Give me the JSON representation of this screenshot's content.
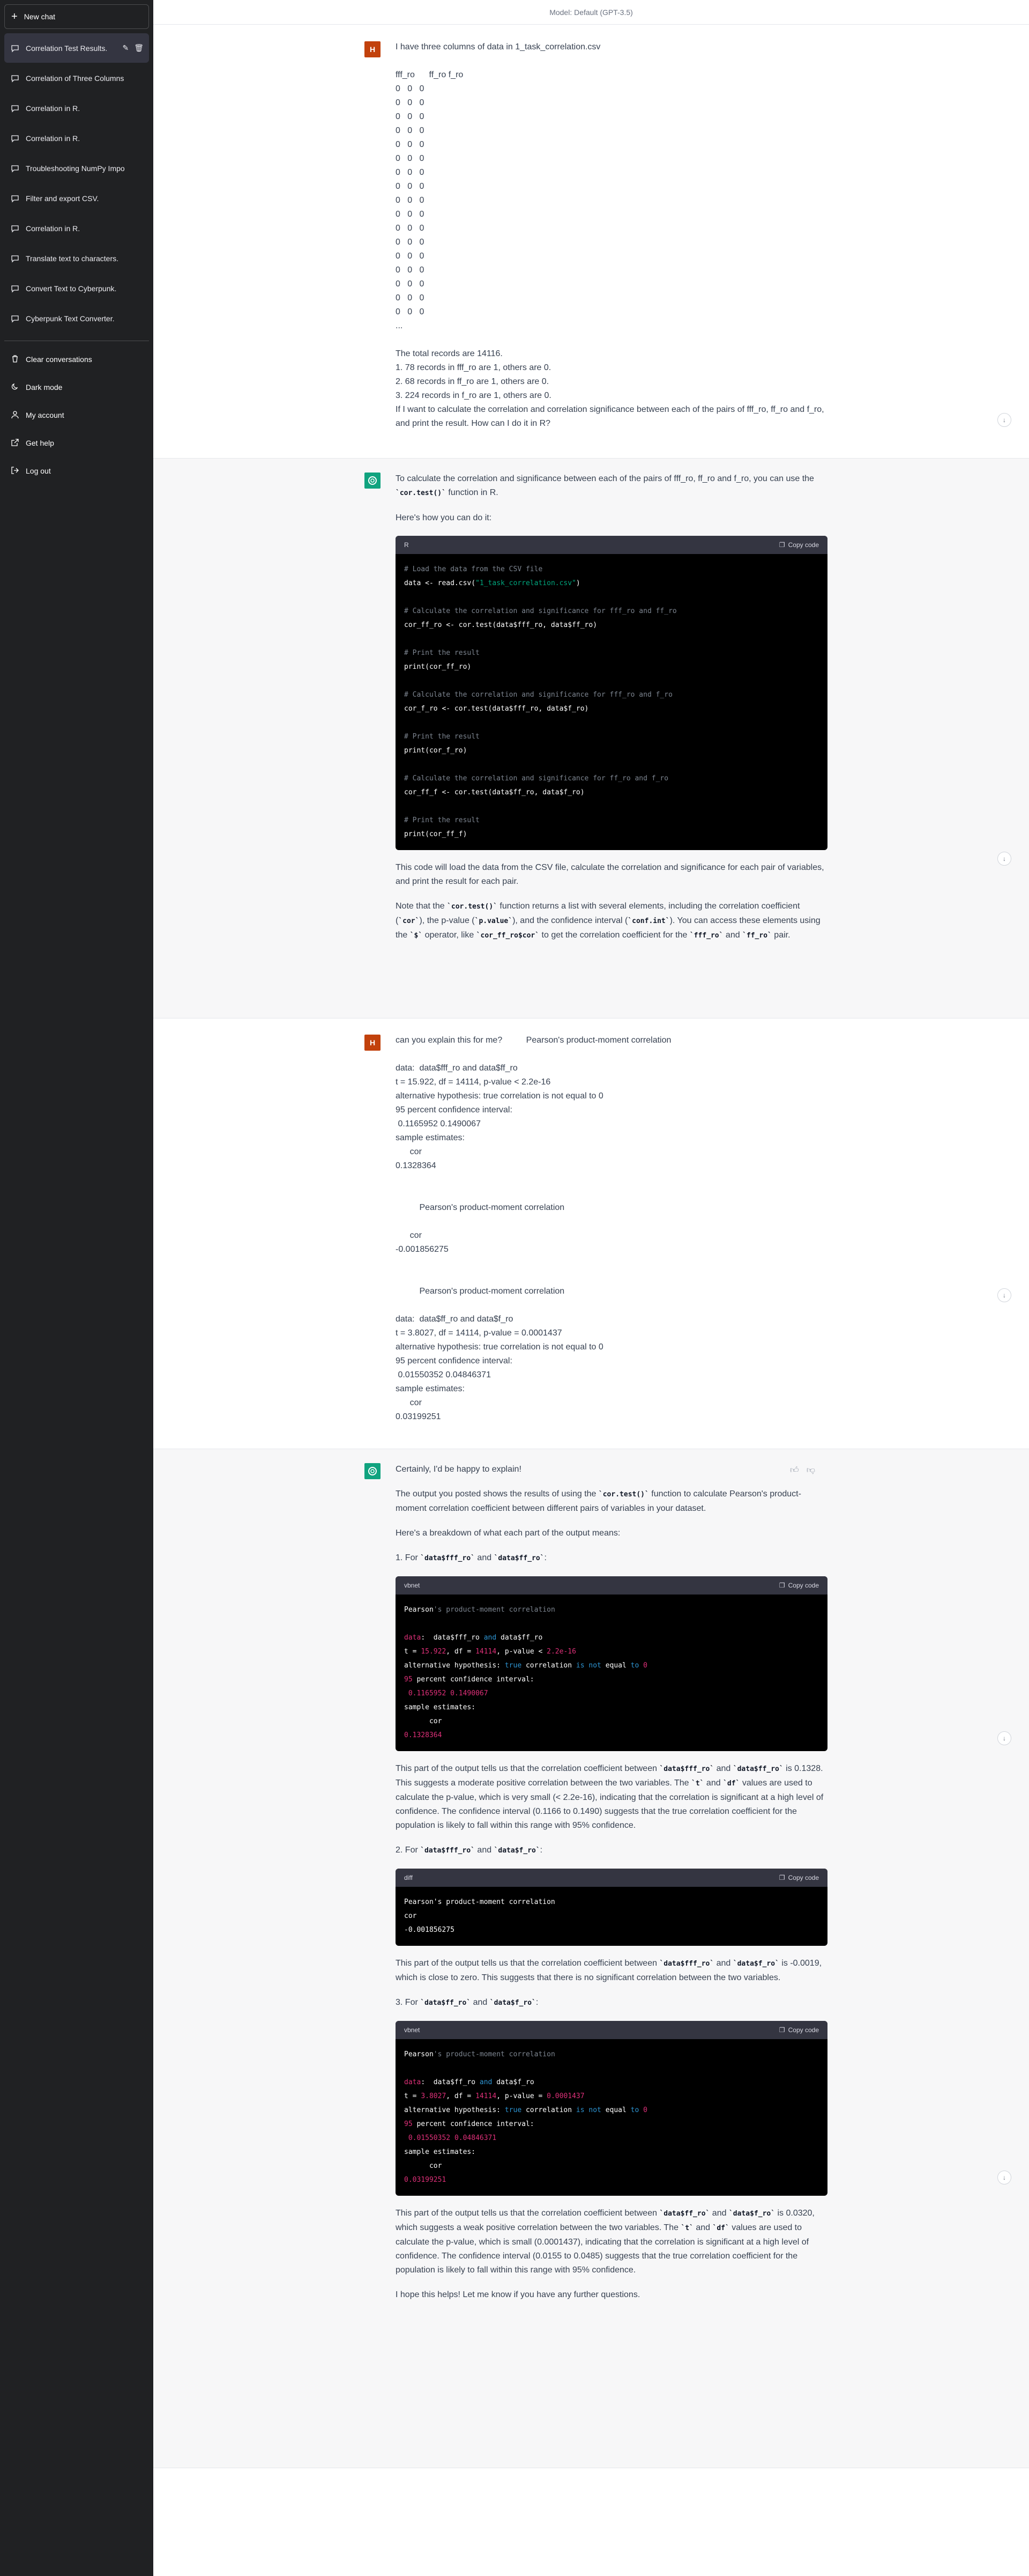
{
  "header": {
    "model": "Model: Default (GPT-3.5)"
  },
  "sidebar": {
    "new_chat": "New chat",
    "conversations": [
      "Correlation Test Results.",
      "Correlation of Three Columns",
      "Correlation in R.",
      "Correlation in R.",
      "Troubleshooting NumPy Impo",
      "Filter and export CSV.",
      "Correlation in R.",
      "Translate text to characters.",
      "Convert Text to Cyberpunk.",
      "Cyberpunk Text Converter."
    ],
    "menu": [
      "Clear conversations",
      "Dark mode",
      "My account",
      "Get help",
      "Log out"
    ]
  },
  "msg1": {
    "avatar": "H",
    "text": "I have three columns of data in 1_task_correlation.csv\n\nfff_ro      ff_ro f_ro\n0   0   0\n0   0   0\n0   0   0\n0   0   0\n0   0   0\n0   0   0\n0   0   0\n0   0   0\n0   0   0\n0   0   0\n0   0   0\n0   0   0\n0   0   0\n0   0   0\n0   0   0\n0   0   0\n0   0   0\n...\n\nThe total records are 14116.\n1. 78 records in fff_ro are 1, others are 0.\n2. 68 records in ff_ro are 1, others are 0.\n3. 224 records in f_ro are 1, others are 0.\nIf I want to calculate the correlation and correlation significance between each of the pairs of fff_ro, ff_ro and f_ro, and print the result. How can I do it in R?"
  },
  "msg2": {
    "p1a": "To calculate the correlation and significance between each of the pairs of fff_ro, ff_ro and f_ro, you can use the ",
    "p1code": "`cor.test()`",
    "p1b": " function in R.",
    "p2": "Here's how you can do it:",
    "code_lang": "R",
    "copy_label": "Copy code",
    "code": [
      {
        "t": "# Load the data from the CSV file",
        "c": "com"
      },
      {
        "t": "data <- read.csv(",
        "c": "",
        "s": "\"1_task_correlation.csv\"",
        "e": ")"
      },
      {
        "t": "",
        "c": ""
      },
      {
        "t": "# Calculate the correlation and significance for fff_ro and ff_ro",
        "c": "com"
      },
      {
        "t": "cor_ff_ro <- cor.test(data$fff_ro, data$ff_ro)",
        "c": ""
      },
      {
        "t": "",
        "c": ""
      },
      {
        "t": "# Print the result",
        "c": "com"
      },
      {
        "t": "print(cor_ff_ro)",
        "c": ""
      },
      {
        "t": "",
        "c": ""
      },
      {
        "t": "# Calculate the correlation and significance for fff_ro and f_ro",
        "c": "com"
      },
      {
        "t": "cor_f_ro <- cor.test(data$fff_ro, data$f_ro)",
        "c": ""
      },
      {
        "t": "",
        "c": ""
      },
      {
        "t": "# Print the result",
        "c": "com"
      },
      {
        "t": "print(cor_f_ro)",
        "c": ""
      },
      {
        "t": "",
        "c": ""
      },
      {
        "t": "# Calculate the correlation and significance for ff_ro and f_ro",
        "c": "com"
      },
      {
        "t": "cor_ff_f <- cor.test(data$ff_ro, data$f_ro)",
        "c": ""
      },
      {
        "t": "",
        "c": ""
      },
      {
        "t": "# Print the result",
        "c": "com"
      },
      {
        "t": "print(cor_ff_f)",
        "c": ""
      }
    ],
    "p3": "This code will load the data from the CSV file, calculate the correlation and significance for each pair of variables, and print the result for each pair.",
    "p4": [
      {
        "t": "Note that the "
      },
      {
        "t": "`cor.test()`",
        "code": true
      },
      {
        "t": " function returns a list with several elements, including the correlation coefficient ("
      },
      {
        "t": "`cor`",
        "code": true
      },
      {
        "t": "), the p-value ("
      },
      {
        "t": "`p.value`",
        "code": true
      },
      {
        "t": "), and the confidence interval ("
      },
      {
        "t": "`conf.int`",
        "code": true
      },
      {
        "t": "). You can access these elements using the "
      },
      {
        "t": "`$`",
        "code": true
      },
      {
        "t": " operator, like "
      },
      {
        "t": "`cor_ff_ro$cor`",
        "code": true
      },
      {
        "t": " to get the correlation coefficient for the "
      },
      {
        "t": "`fff_ro`",
        "code": true
      },
      {
        "t": " and "
      },
      {
        "t": "`ff_ro`",
        "code": true
      },
      {
        "t": " pair."
      }
    ]
  },
  "msg3": {
    "avatar": "H",
    "text": "can you explain this for me?          Pearson's product-moment correlation\n\ndata:  data$fff_ro and data$ff_ro\nt = 15.922, df = 14114, p-value < 2.2e-16\nalternative hypothesis: true correlation is not equal to 0\n95 percent confidence interval:\n 0.1165952 0.1490067\nsample estimates:\n      cor\n0.1328364\n\n\n          Pearson's product-moment correlation\n\n      cor\n-0.001856275\n\n\n          Pearson's product-moment correlation\n\ndata:  data$ff_ro and data$f_ro\nt = 3.8027, df = 14114, p-value = 0.0001437\nalternative hypothesis: true correlation is not equal to 0\n95 percent confidence interval:\n 0.01550352 0.04846371\nsample estimates:\n      cor\n0.03199251"
  },
  "msg4": {
    "p1": "Certainly, I'd be happy to explain!",
    "p2": [
      {
        "t": "The output you posted shows the results of using the "
      },
      {
        "t": "`cor.test()`",
        "code": true
      },
      {
        "t": " function to calculate Pearson's product-moment correlation coefficient between different pairs of variables in your dataset."
      }
    ],
    "p3": "Here's a breakdown of what each part of the output means:",
    "item1": [
      {
        "t": "1.  For "
      },
      {
        "t": "`data$fff_ro`",
        "code": true
      },
      {
        "t": " and "
      },
      {
        "t": "`data$ff_ro`",
        "code": true
      },
      {
        "t": ":"
      }
    ],
    "code1_lang": "vbnet",
    "code1": [
      [
        {
          "t": "Pearson",
          "c": ""
        },
        {
          "t": "'s product-moment correlation",
          "c": "com"
        }
      ],
      [
        {
          "t": "",
          "c": ""
        }
      ],
      [
        {
          "t": "data",
          "c": "red"
        },
        {
          "t": ":  data$fff_ro ",
          "c": ""
        },
        {
          "t": "and",
          "c": "kw"
        },
        {
          "t": " data$ff_ro",
          "c": ""
        }
      ],
      [
        {
          "t": "t = ",
          "c": ""
        },
        {
          "t": "15.922",
          "c": "red"
        },
        {
          "t": ", df = ",
          "c": ""
        },
        {
          "t": "14114",
          "c": "red"
        },
        {
          "t": ", p-value < ",
          "c": ""
        },
        {
          "t": "2.2e-16",
          "c": "red"
        }
      ],
      [
        {
          "t": "alternative hypothesis: ",
          "c": ""
        },
        {
          "t": "true",
          "c": "kw"
        },
        {
          "t": " correlation ",
          "c": ""
        },
        {
          "t": "is",
          "c": "kw"
        },
        {
          "t": " ",
          "c": ""
        },
        {
          "t": "not",
          "c": "kw"
        },
        {
          "t": " equal ",
          "c": ""
        },
        {
          "t": "to",
          "c": "kw"
        },
        {
          "t": " ",
          "c": ""
        },
        {
          "t": "0",
          "c": "red"
        }
      ],
      [
        {
          "t": "95",
          "c": "red"
        },
        {
          "t": " percent confidence interval:",
          "c": ""
        }
      ],
      [
        {
          "t": " ",
          "c": ""
        },
        {
          "t": "0.1165952",
          "c": "red"
        },
        {
          "t": " ",
          "c": ""
        },
        {
          "t": "0.1490067",
          "c": "red"
        }
      ],
      [
        {
          "t": "sample estimates:",
          "c": ""
        }
      ],
      [
        {
          "t": "      cor",
          "c": ""
        }
      ],
      [
        {
          "t": "0.1328364",
          "c": "red"
        }
      ]
    ],
    "p4": [
      {
        "t": "This part of the output tells us that the correlation coefficient between "
      },
      {
        "t": "`data$fff_ro`",
        "code": true
      },
      {
        "t": " and "
      },
      {
        "t": "`data$ff_ro`",
        "code": true
      },
      {
        "t": " is 0.1328. This suggests a moderate positive correlation between the two variables. The "
      },
      {
        "t": "`t`",
        "code": true
      },
      {
        "t": " and "
      },
      {
        "t": "`df`",
        "code": true
      },
      {
        "t": " values are used to calculate the p-value, which is very small (< 2.2e-16), indicating that the correlation is significant at a high level of confidence. The confidence interval (0.1166 to 0.1490) suggests that the true correlation coefficient for the population is likely to fall within this range with 95% confidence."
      }
    ],
    "item2": [
      {
        "t": "2.  For "
      },
      {
        "t": "`data$fff_ro`",
        "code": true
      },
      {
        "t": " and "
      },
      {
        "t": "`data$f_ro`",
        "code": true
      },
      {
        "t": ":"
      }
    ],
    "code2_lang": "diff",
    "code2": [
      [
        {
          "t": "Pearson's product-moment correlation",
          "c": ""
        }
      ],
      [
        {
          "t": "cor",
          "c": ""
        }
      ],
      [
        {
          "t": "-0.001856275",
          "c": ""
        }
      ]
    ],
    "p5": [
      {
        "t": "This part of the output tells us that the correlation coefficient between "
      },
      {
        "t": "`data$fff_ro`",
        "code": true
      },
      {
        "t": " and "
      },
      {
        "t": "`data$f_ro`",
        "code": true
      },
      {
        "t": " is -0.0019, which is close to zero. This suggests that there is no significant correlation between the two variables."
      }
    ],
    "item3": [
      {
        "t": "3.  For "
      },
      {
        "t": "`data$ff_ro`",
        "code": true
      },
      {
        "t": " and "
      },
      {
        "t": "`data$f_ro`",
        "code": true
      },
      {
        "t": ":"
      }
    ],
    "code3_lang": "vbnet",
    "code3": [
      [
        {
          "t": "Pearson",
          "c": ""
        },
        {
          "t": "'s product-moment correlation",
          "c": "com"
        }
      ],
      [
        {
          "t": "",
          "c": ""
        }
      ],
      [
        {
          "t": "data",
          "c": "red"
        },
        {
          "t": ":  data$ff_ro ",
          "c": ""
        },
        {
          "t": "and",
          "c": "kw"
        },
        {
          "t": " data$f_ro",
          "c": ""
        }
      ],
      [
        {
          "t": "t = ",
          "c": ""
        },
        {
          "t": "3.8027",
          "c": "red"
        },
        {
          "t": ", df = ",
          "c": ""
        },
        {
          "t": "14114",
          "c": "red"
        },
        {
          "t": ", p-value = ",
          "c": ""
        },
        {
          "t": "0.0001437",
          "c": "red"
        }
      ],
      [
        {
          "t": "alternative hypothesis: ",
          "c": ""
        },
        {
          "t": "true",
          "c": "kw"
        },
        {
          "t": " correlation ",
          "c": ""
        },
        {
          "t": "is",
          "c": "kw"
        },
        {
          "t": " ",
          "c": ""
        },
        {
          "t": "not",
          "c": "kw"
        },
        {
          "t": " equal ",
          "c": ""
        },
        {
          "t": "to",
          "c": "kw"
        },
        {
          "t": " ",
          "c": ""
        },
        {
          "t": "0",
          "c": "red"
        }
      ],
      [
        {
          "t": "95",
          "c": "red"
        },
        {
          "t": " percent confidence interval:",
          "c": ""
        }
      ],
      [
        {
          "t": " ",
          "c": ""
        },
        {
          "t": "0.01550352",
          "c": "red"
        },
        {
          "t": " ",
          "c": ""
        },
        {
          "t": "0.04846371",
          "c": "red"
        }
      ],
      [
        {
          "t": "sample estimates:",
          "c": ""
        }
      ],
      [
        {
          "t": "      cor",
          "c": ""
        }
      ],
      [
        {
          "t": "0.03199251",
          "c": "red"
        }
      ]
    ],
    "p6": [
      {
        "t": "This part of the output tells us that the correlation coefficient between "
      },
      {
        "t": "`data$ff_ro`",
        "code": true
      },
      {
        "t": " and "
      },
      {
        "t": "`data$f_ro`",
        "code": true
      },
      {
        "t": " is 0.0320, which suggests a weak positive correlation between the two variables. The "
      },
      {
        "t": "`t`",
        "code": true
      },
      {
        "t": " and "
      },
      {
        "t": "`df`",
        "code": true
      },
      {
        "t": " values are used to calculate the p-value, which is small (0.0001437), indicating that the correlation is significant at a high level of confidence. The confidence interval (0.0155 to 0.0485) suggests that the true correlation coefficient for the population is likely to fall within this range with 95% confidence."
      }
    ],
    "p7": "I hope this helps! Let me know if you have any further questions."
  },
  "colors": {
    "sidebar": "#202123",
    "user_avatar": "#c2410c",
    "bot_avatar": "#10a37f",
    "code_bg": "#000000"
  }
}
